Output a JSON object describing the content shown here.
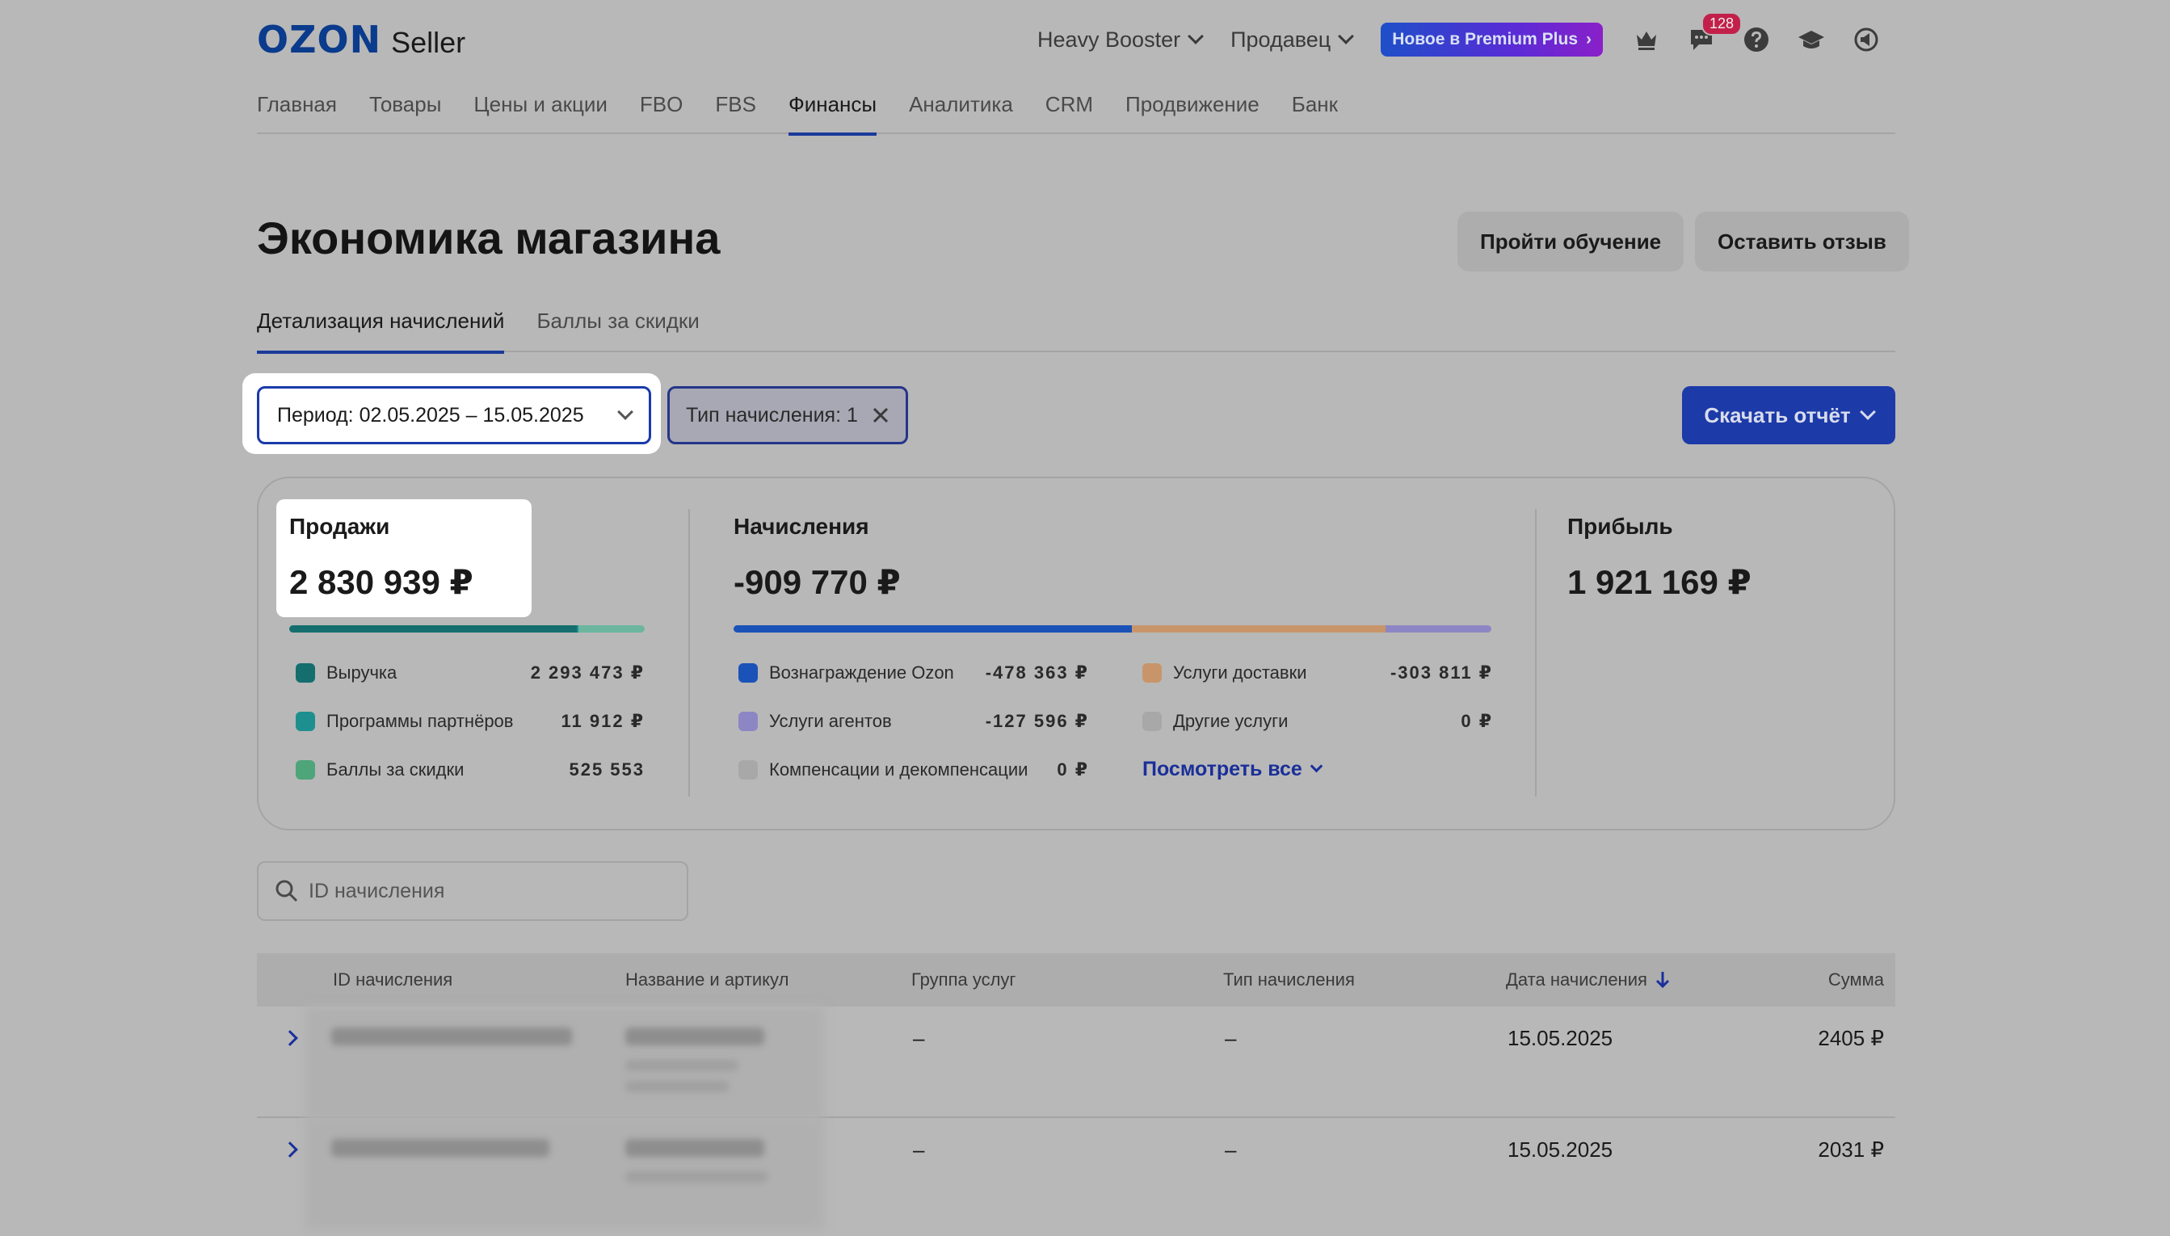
{
  "header": {
    "logo_brand": "OZON",
    "logo_product": "Seller",
    "account": "Heavy Booster",
    "role": "Продавец",
    "premium_label": "Новое в Premium Plus",
    "premium_arrow": "›",
    "messages_count": "128"
  },
  "nav": {
    "items": [
      "Главная",
      "Товары",
      "Цены и акции",
      "FBO",
      "FBS",
      "Финансы",
      "Аналитика",
      "CRM",
      "Продвижение",
      "Банк"
    ],
    "active": "Финансы"
  },
  "page": {
    "title": "Экономика магазина",
    "learn_button": "Пройти обучение",
    "review_button": "Оставить отзыв"
  },
  "subtabs": {
    "items": [
      "Детализация начислений",
      "Баллы за скидки"
    ],
    "active": "Детализация начислений"
  },
  "filters": {
    "period": "Период: 02.05.2025 – 15.05.2025",
    "type": "Тип начисления: 1",
    "download": "Скачать отчёт"
  },
  "summary": {
    "sales": {
      "title": "Продажи",
      "value": "2 830 939 ₽",
      "legend": [
        {
          "label": "Выручка",
          "value": "2 293 473 ₽",
          "color": "#156e6e",
          "share": 0.81
        },
        {
          "label": "Программы партнёров",
          "value": "11 912 ₽",
          "color": "#1e8f8f",
          "share": 0.004
        },
        {
          "label": "Баллы за скидки",
          "value": "525 553",
          "color": "#4ea57a",
          "share": 0.186
        }
      ]
    },
    "accruals": {
      "title": "Начисления",
      "value": "-909 770 ₽",
      "legend": [
        {
          "label": "Вознаграждение Ozon",
          "value": "-478 363 ₽",
          "color": "#1a52b8",
          "share": 0.526
        },
        {
          "label": "Услуги агентов",
          "value": "-127 596 ₽",
          "color": "#8d86c4",
          "share": 0.14
        },
        {
          "label": "Компенсации и декомпенсации",
          "value": "0 ₽",
          "color": "#a8a8a8",
          "share": 0
        },
        {
          "label": "Услуги доставки",
          "value": "-303 811 ₽",
          "color": "#c8956a",
          "share": 0.334
        },
        {
          "label": "Другие услуги",
          "value": "0 ₽",
          "color": "#a8a8a8",
          "share": 0
        }
      ],
      "more_link": "Посмотреть все"
    },
    "profit": {
      "title": "Прибыль",
      "value": "1 921 169 ₽"
    }
  },
  "search": {
    "placeholder": "ID начисления"
  },
  "table": {
    "columns": [
      "ID начисления",
      "Название и артикул",
      "Группа услуг",
      "Тип начисления",
      "Дата начисления",
      "Сумма"
    ],
    "rows": [
      {
        "group": "–",
        "type": "–",
        "date": "15.05.2025",
        "amount": "2405 ₽"
      },
      {
        "group": "–",
        "type": "–",
        "date": "15.05.2025",
        "amount": "2031 ₽"
      }
    ]
  }
}
